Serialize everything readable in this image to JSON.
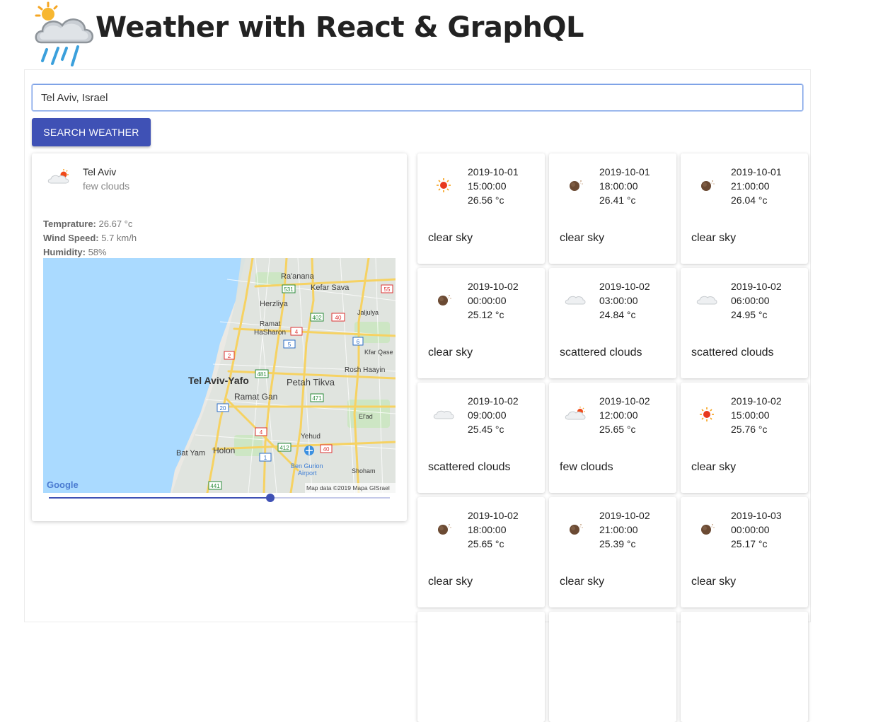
{
  "app": {
    "title": "Weather with React & GraphQL"
  },
  "search": {
    "value": "Tel Aviv, Israel",
    "button_label": "SEARCH WEATHER"
  },
  "current": {
    "city": "Tel Aviv",
    "description": "few clouds",
    "icon": "few-clouds-day-icon",
    "temperature_label": "Temprature:",
    "temperature_value": "26.67 °c",
    "wind_label": "Wind Speed:",
    "wind_value": "5.7 km/h",
    "humidity_label": "Humidity:",
    "humidity_value": "58%"
  },
  "map": {
    "attribution": "Map data ©2019 Mapa GISrael",
    "provider": "Google",
    "labels": {
      "raanana": "Ra'anana",
      "kefar_sava": "Kefar Sava",
      "herzliya": "Herzliya",
      "jaljulya": "Jaljulya",
      "ramat_hasharon_1": "Ramat",
      "ramat_hasharon_2": "HaSharon",
      "kfar_qasem": "Kfar Qase",
      "rosh_haayin": "Rosh Haayin",
      "tel_aviv_yafo": "Tel Aviv-Yafo",
      "petah_tikva": "Petah Tikva",
      "ramat_gan": "Ramat Gan",
      "elad": "El'ad",
      "yehud": "Yehud",
      "bat_yam": "Bat Yam",
      "holon": "Holon",
      "ben_gurion_1": "Ben Gurion",
      "ben_gurion_2": "Airport",
      "shoham": "Shoham"
    },
    "road_shields": {
      "r531": "531",
      "r55": "55",
      "r402": "402",
      "r40a": "40",
      "r4a": "4",
      "r5": "5",
      "r6": "6",
      "r2": "2",
      "r481": "481",
      "r471": "471",
      "r20": "20",
      "r4b": "4",
      "r412": "412",
      "r40b": "40",
      "r1": "1",
      "r441": "441"
    }
  },
  "slider": {
    "value_fraction": 0.65
  },
  "forecast": [
    {
      "date": "2019-10-01",
      "time": "15:00:00",
      "temp": "26.56 °c",
      "desc": "clear sky",
      "icon": "sun-icon"
    },
    {
      "date": "2019-10-01",
      "time": "18:00:00",
      "temp": "26.41 °c",
      "desc": "clear sky",
      "icon": "moon-icon"
    },
    {
      "date": "2019-10-01",
      "time": "21:00:00",
      "temp": "26.04 °c",
      "desc": "clear sky",
      "icon": "moon-icon"
    },
    {
      "date": "2019-10-02",
      "time": "00:00:00",
      "temp": "25.12 °c",
      "desc": "clear sky",
      "icon": "moon-icon"
    },
    {
      "date": "2019-10-02",
      "time": "03:00:00",
      "temp": "24.84 °c",
      "desc": "scattered clouds",
      "icon": "cloud-icon"
    },
    {
      "date": "2019-10-02",
      "time": "06:00:00",
      "temp": "24.95 °c",
      "desc": "scattered clouds",
      "icon": "cloud-icon"
    },
    {
      "date": "2019-10-02",
      "time": "09:00:00",
      "temp": "25.45 °c",
      "desc": "scattered clouds",
      "icon": "cloud-icon"
    },
    {
      "date": "2019-10-02",
      "time": "12:00:00",
      "temp": "25.65 °c",
      "desc": "few clouds",
      "icon": "few-clouds-day-icon"
    },
    {
      "date": "2019-10-02",
      "time": "15:00:00",
      "temp": "25.76 °c",
      "desc": "clear sky",
      "icon": "sun-icon"
    },
    {
      "date": "2019-10-02",
      "time": "18:00:00",
      "temp": "25.65 °c",
      "desc": "clear sky",
      "icon": "moon-icon"
    },
    {
      "date": "2019-10-02",
      "time": "21:00:00",
      "temp": "25.39 °c",
      "desc": "clear sky",
      "icon": "moon-icon"
    },
    {
      "date": "2019-10-03",
      "time": "00:00:00",
      "temp": "25.17 °c",
      "desc": "clear sky",
      "icon": "moon-icon"
    }
  ],
  "colors": {
    "primary": "#3f51b5",
    "water": "#aadaff",
    "road": "#f6d262",
    "shield_red": "#d33",
    "shield_green": "#2a8a3a",
    "shield_blue": "#2b6cc4"
  }
}
